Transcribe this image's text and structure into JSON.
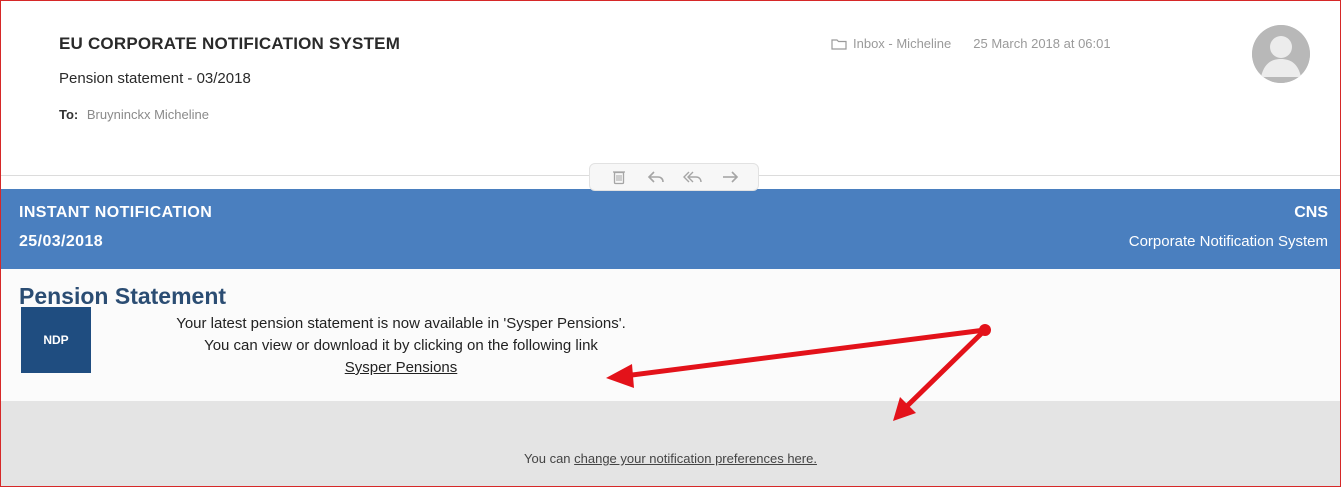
{
  "mail": {
    "sender": "EU CORPORATE NOTIFICATION SYSTEM",
    "subject": "Pension statement - 03/2018",
    "to_label": "To:",
    "to_name": "Bruyninckx Micheline",
    "folder": "Inbox - Micheline",
    "date": "25 March 2018 at 06:01",
    "folder_icon": "folder-icon",
    "avatar_icon": "person-silhouette-icon"
  },
  "toolbar": {
    "icons": [
      "trash-icon",
      "reply-icon",
      "reply-all-icon",
      "forward-icon"
    ]
  },
  "banner": {
    "title": "INSTANT NOTIFICATION",
    "date": "25/03/2018",
    "code": "CNS",
    "system_name": "Corporate Notification System",
    "color": "#4a7fbf"
  },
  "content": {
    "title": "Pension Statement",
    "badge": "NDP",
    "line1": "Your latest pension statement is now available in 'Sysper Pensions'.",
    "line2": "You can view or download it by clicking on the following link",
    "link_label": "Sysper Pensions"
  },
  "footer": {
    "prefix": "You can ",
    "link_label": "change your notification preferences here."
  },
  "annotation": {
    "color": "#e3121a"
  }
}
